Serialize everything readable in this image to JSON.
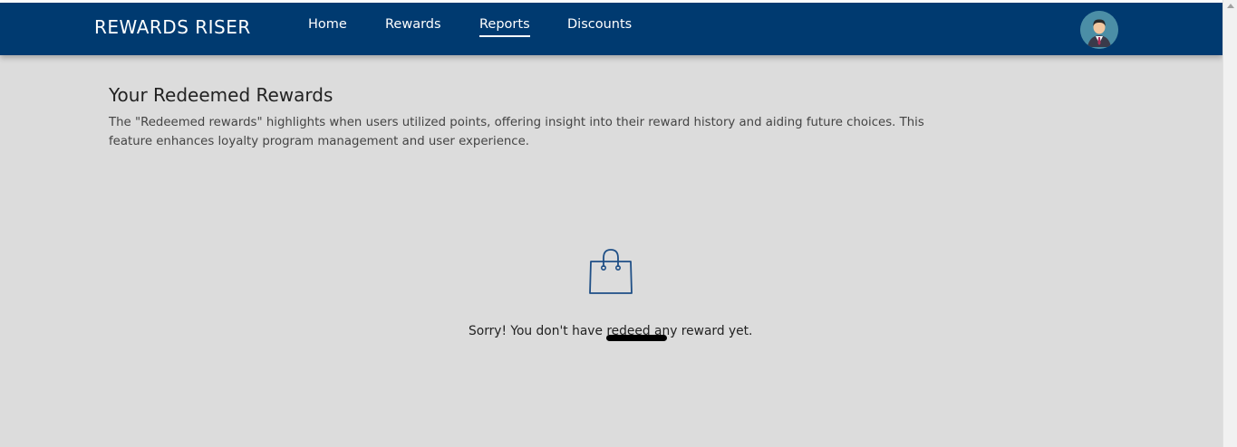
{
  "navbar": {
    "brand": "REWARDS RISER",
    "items": [
      {
        "label": "Home"
      },
      {
        "label": "Rewards"
      },
      {
        "label": "Reports",
        "active": true
      },
      {
        "label": "Discounts"
      }
    ],
    "background": "#003a70"
  },
  "main": {
    "title": "Your Redeemed Rewards",
    "description": "The \"Redeemed rewards\" highlights when users utilized points, offering insight into their reward history and aiding future choices. This feature enhances loyalty program management and user experience.",
    "empty_state": {
      "icon": "shopping-bag-icon",
      "message": "Sorry! You don't have redeed any reward yet."
    }
  }
}
